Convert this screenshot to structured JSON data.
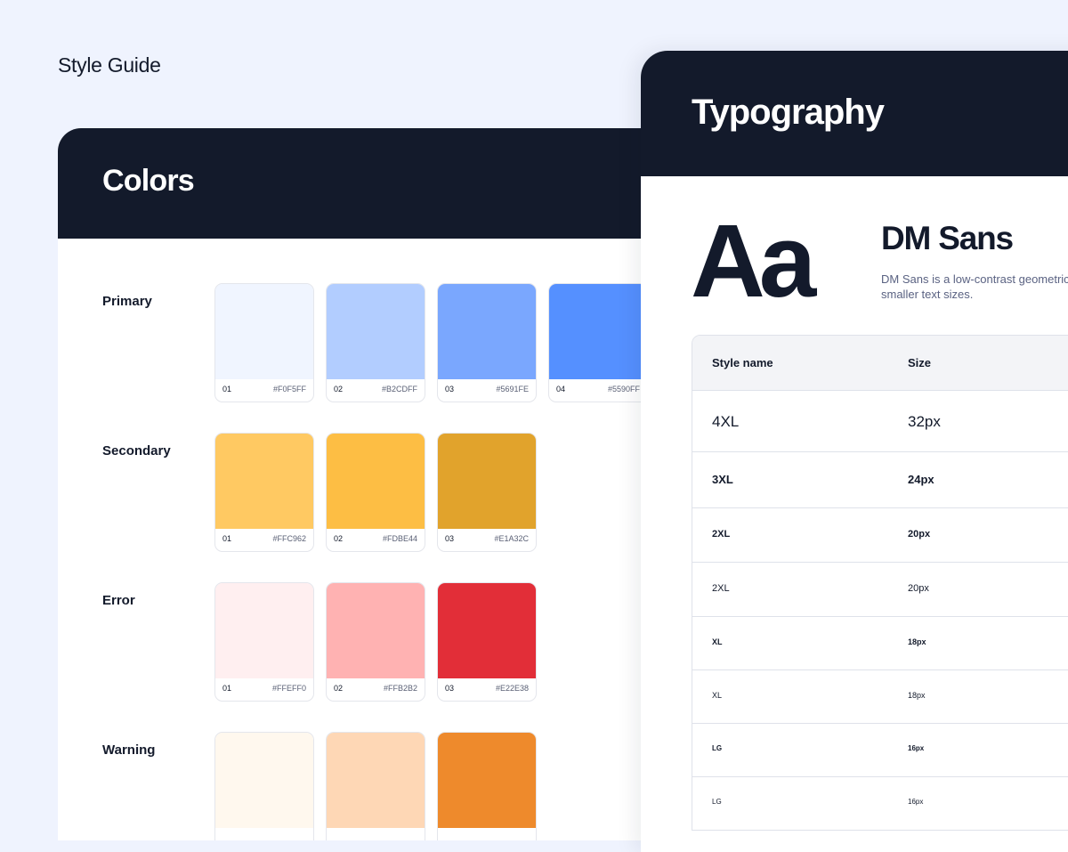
{
  "page_title": "Style Guide",
  "colors": {
    "title": "Colors",
    "groups": [
      {
        "label": "Primary",
        "swatches": [
          {
            "num": "01",
            "hex": "#F0F5FF",
            "color": "#F0F5FF"
          },
          {
            "num": "02",
            "hex": "#B2CDFF",
            "color": "#B2CDFF"
          },
          {
            "num": "03",
            "hex": "#5691FE",
            "color": "#7AA7FE"
          },
          {
            "num": "04",
            "hex": "#5590FF",
            "color": "#5590FF"
          }
        ]
      },
      {
        "label": "Secondary",
        "swatches": [
          {
            "num": "01",
            "hex": "#FFC962",
            "color": "#FFC962"
          },
          {
            "num": "02",
            "hex": "#FDBE44",
            "color": "#FDBE44"
          },
          {
            "num": "03",
            "hex": "#E1A32C",
            "color": "#E1A32C"
          }
        ]
      },
      {
        "label": "Error",
        "swatches": [
          {
            "num": "01",
            "hex": "#FFEFF0",
            "color": "#FFEFF0"
          },
          {
            "num": "02",
            "hex": "#FFB2B2",
            "color": "#FFB2B2"
          },
          {
            "num": "03",
            "hex": "#E22E38",
            "color": "#E22E38"
          }
        ]
      },
      {
        "label": "Warning",
        "swatches": [
          {
            "color": "#FFF8EE"
          },
          {
            "color": "#FED7B5"
          },
          {
            "color": "#EE8A2C"
          }
        ]
      }
    ]
  },
  "typography": {
    "title": "Typography",
    "glyph": "Aa",
    "font_name": "DM Sans",
    "description_line1": "DM Sans is a low-contrast geometric",
    "description_line2": "smaller text sizes.",
    "table": {
      "headers": {
        "style": "Style name",
        "size": "Size"
      },
      "rows": [
        {
          "style": "4XL",
          "size": "32px",
          "weight": "normal"
        },
        {
          "style": "3XL",
          "size": "24px",
          "weight": "bold"
        },
        {
          "style": "2XL",
          "size": "20px",
          "weight": "bold"
        },
        {
          "style": "2XL",
          "size": "20px",
          "weight": "normal"
        },
        {
          "style": "XL",
          "size": "18px",
          "weight": "bold"
        },
        {
          "style": "XL",
          "size": "18px",
          "weight": "normal"
        },
        {
          "style": "LG",
          "size": "16px",
          "weight": "bold"
        },
        {
          "style": "LG",
          "size": "16px",
          "weight": "normal"
        }
      ]
    }
  }
}
